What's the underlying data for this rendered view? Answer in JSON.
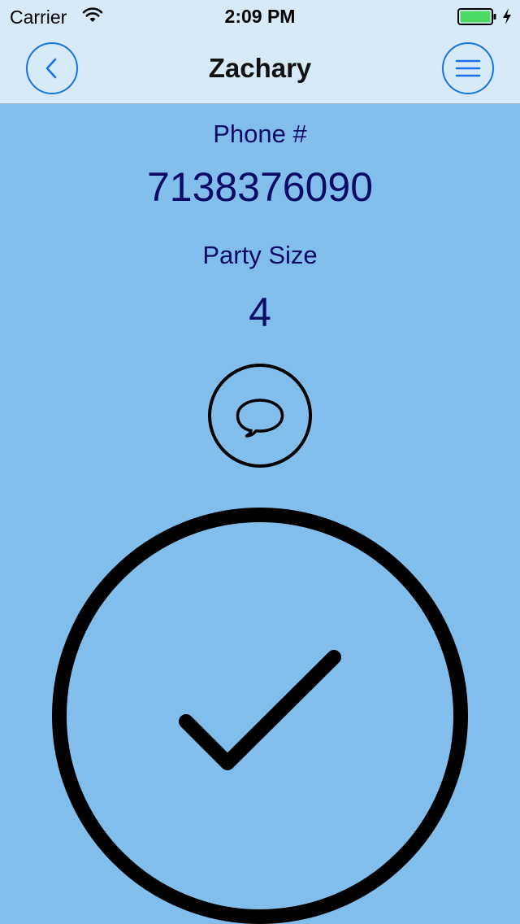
{
  "status_bar": {
    "carrier": "Carrier",
    "time": "2:09 PM",
    "wifi_icon": "wifi-icon",
    "battery_icon": "battery-full-icon",
    "battery_color": "#4CD964",
    "charging_icon": "charging-bolt-icon"
  },
  "nav": {
    "title": "Zachary",
    "back_icon": "chevron-left-icon",
    "menu_icon": "hamburger-menu-icon",
    "accent_color": "#1A73E8",
    "background_color": "#D6EBF7"
  },
  "details": {
    "phone_label": "Phone #",
    "phone_value": "7138376090",
    "party_label": "Party Size",
    "party_value": "4",
    "text_color": "#0C0C66",
    "background_color": "#82BEEC"
  },
  "actions": {
    "message_icon": "speech-bubble-icon",
    "confirm_icon": "checkmark-icon"
  }
}
